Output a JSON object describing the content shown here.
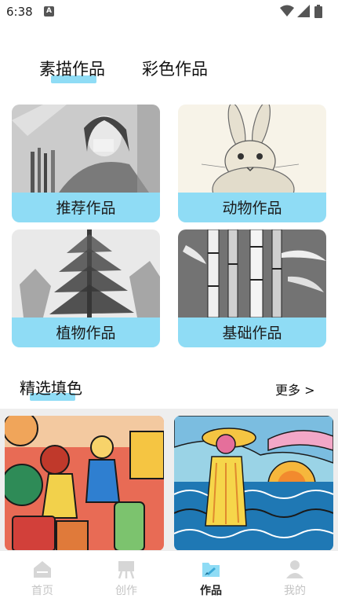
{
  "status_bar": {
    "time": "6:38",
    "notification_icon": "a-badge-icon"
  },
  "tabs": [
    {
      "label": "素描作品",
      "active": true
    },
    {
      "label": "彩色作品",
      "active": false
    }
  ],
  "categories": [
    {
      "label": "推荐作品",
      "art": "girl-sketch"
    },
    {
      "label": "动物作品",
      "art": "rabbit-sketch"
    },
    {
      "label": "植物作品",
      "art": "tree-sketch"
    },
    {
      "label": "基础作品",
      "art": "bamboo-sketch"
    }
  ],
  "featured": {
    "title": "精选填色",
    "more_label": "更多 >",
    "items": [
      "girls-with-luggage",
      "beach-girl"
    ]
  },
  "bottom_nav": [
    {
      "label": "首页",
      "icon": "home-icon",
      "active": false
    },
    {
      "label": "创作",
      "icon": "easel-icon",
      "active": false
    },
    {
      "label": "作品",
      "icon": "artwork-icon",
      "active": true
    },
    {
      "label": "我的",
      "icon": "profile-icon",
      "active": false
    }
  ],
  "colors": {
    "accent": "#8fdcf5",
    "inactive_nav": "#c4c4c4"
  }
}
